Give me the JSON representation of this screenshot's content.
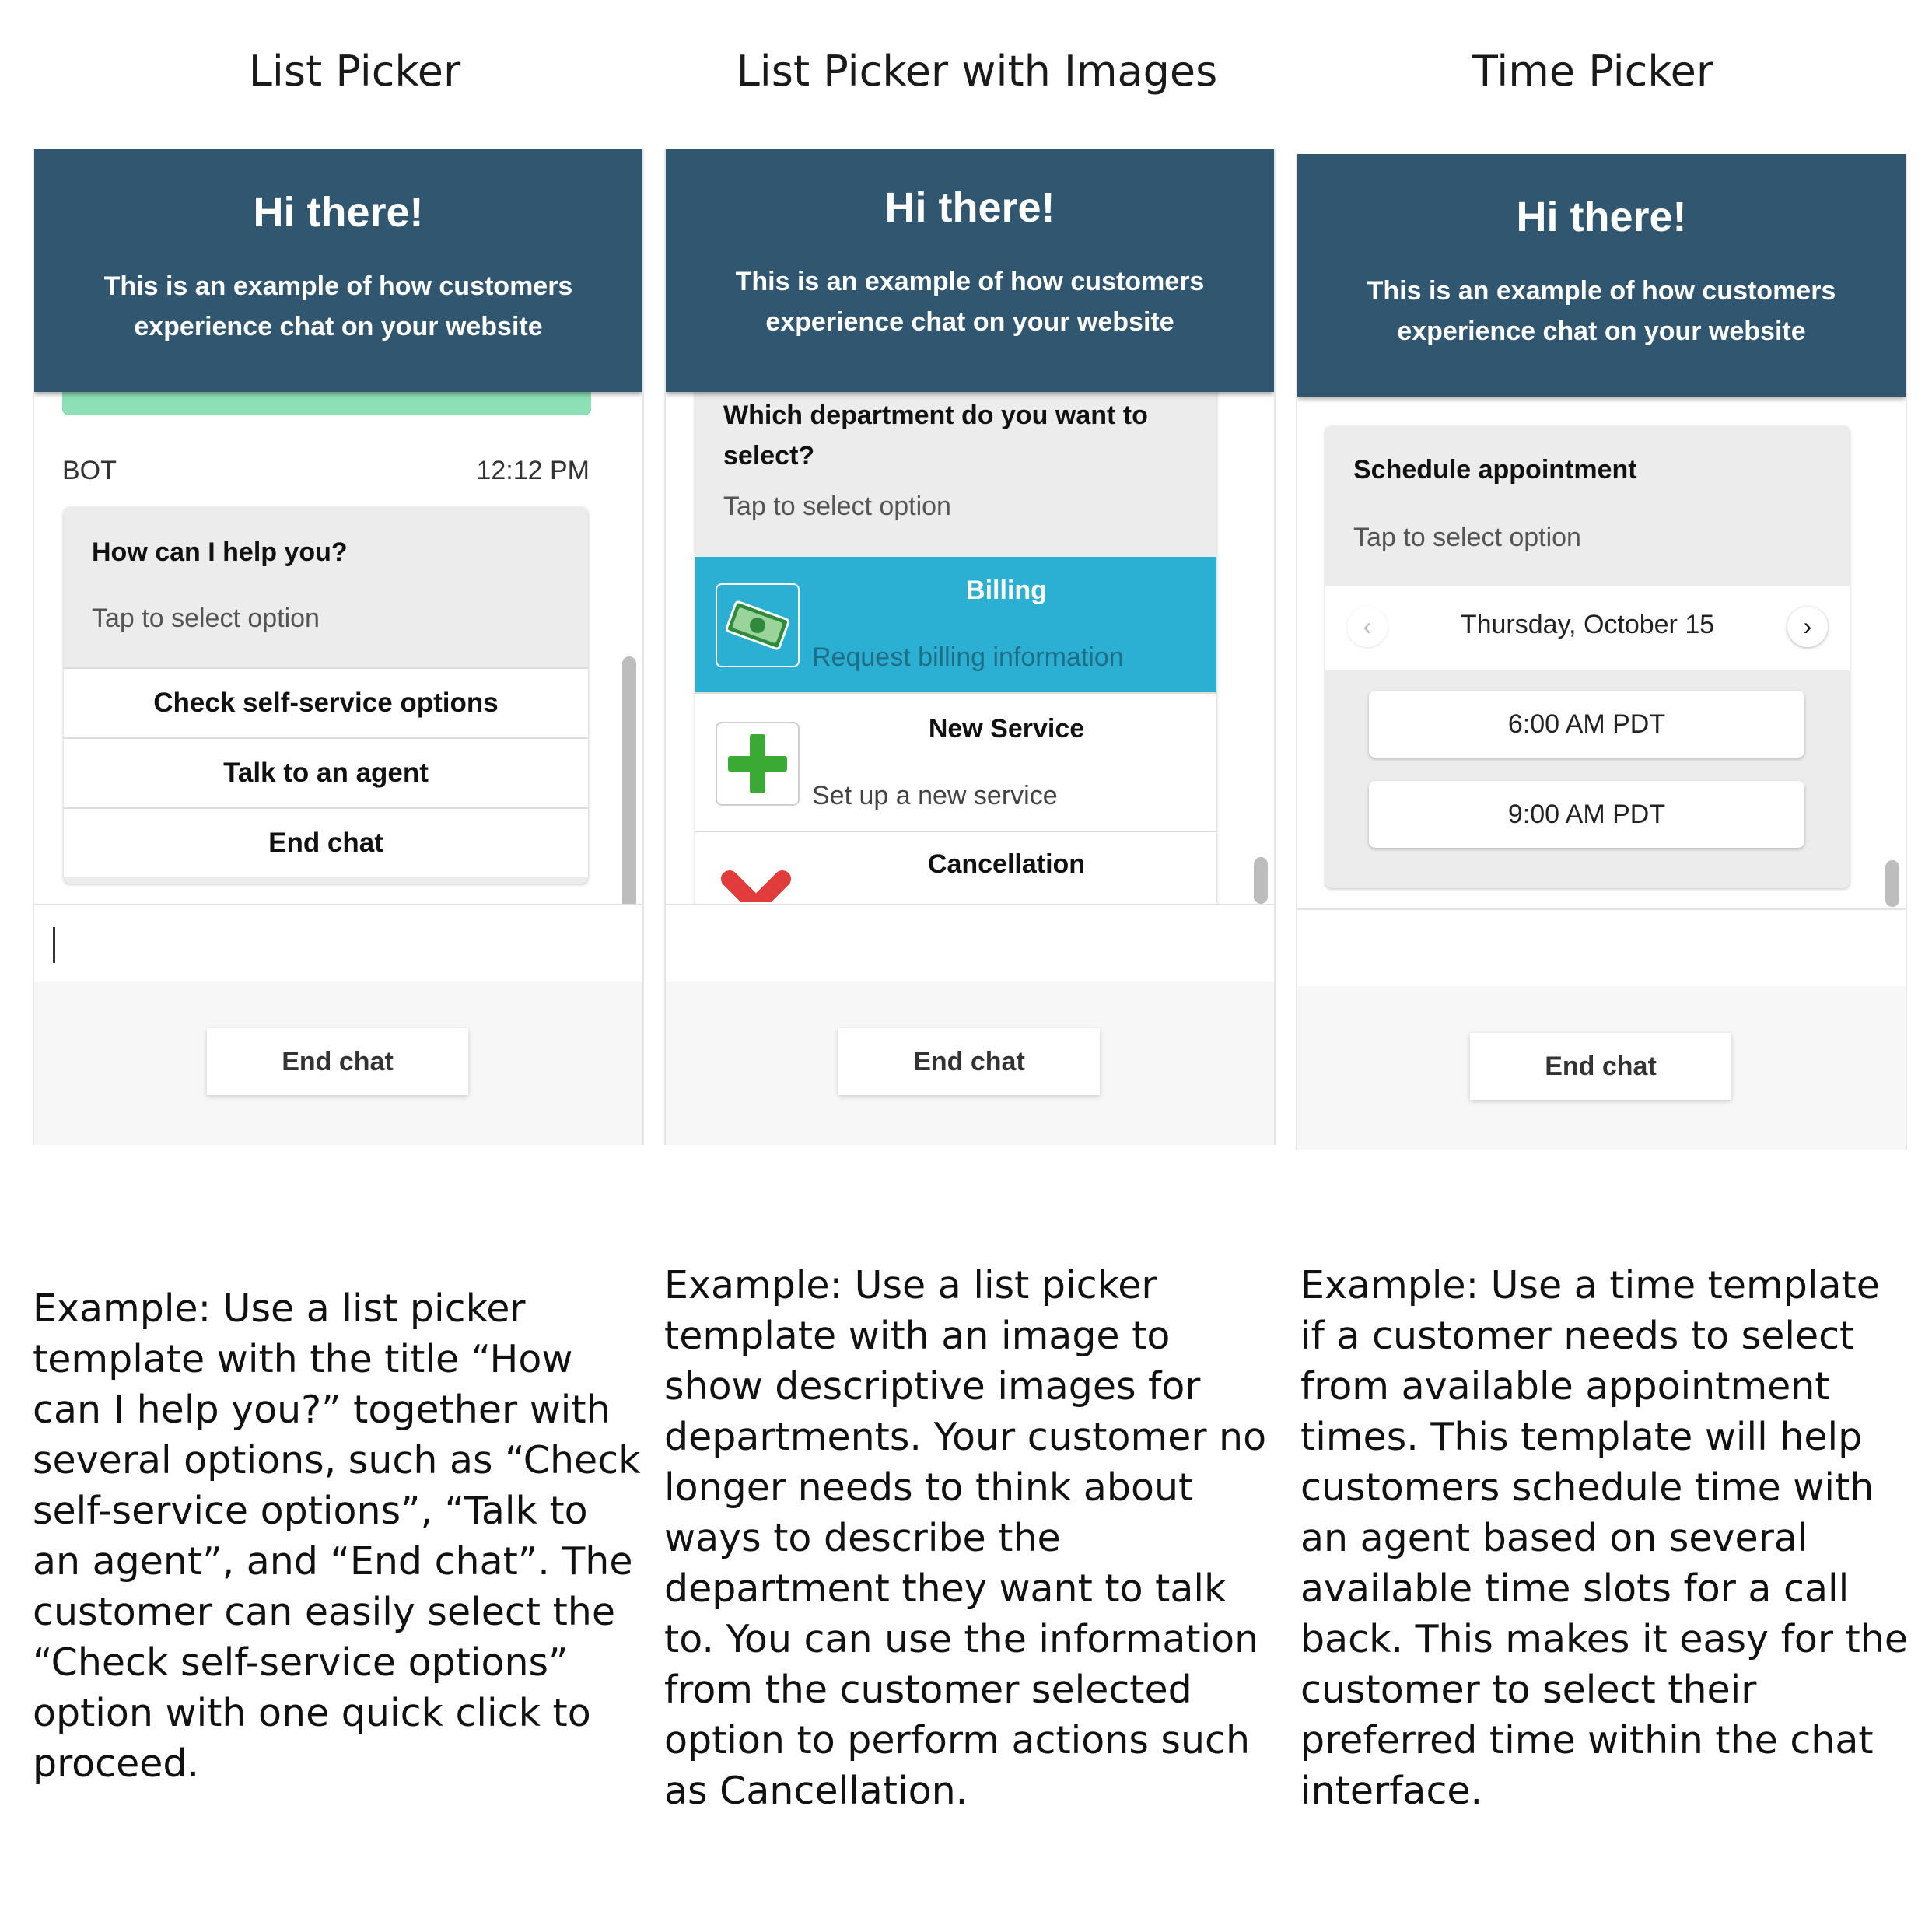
{
  "columns": [
    {
      "title": "List Picker"
    },
    {
      "title": "List Picker with Images"
    },
    {
      "title": "Time Picker"
    }
  ],
  "header": {
    "greeting": "Hi there!",
    "subtitle": "This is an example of how customers experience chat on your website"
  },
  "footer": {
    "end_chat_label": "End chat"
  },
  "list_picker": {
    "sender": "BOT",
    "timestamp": "12:12 PM",
    "card_title": "How can I help you?",
    "card_subtitle": "Tap to select option",
    "options": [
      "Check self-service options",
      "Talk to an agent",
      "End chat"
    ]
  },
  "image_picker": {
    "card_title": "Which department do you want to select?",
    "card_subtitle": "Tap to select option",
    "options": [
      {
        "title": "Billing",
        "subtitle": "Request billing information",
        "icon": "money-icon",
        "selected": true
      },
      {
        "title": "New Service",
        "subtitle": "Set up a new service",
        "icon": "plus-icon",
        "selected": false
      },
      {
        "title": "Cancellation",
        "subtitle": "",
        "icon": "x-icon",
        "selected": false
      }
    ]
  },
  "time_picker": {
    "card_title": "Schedule appointment",
    "card_subtitle": "Tap to select option",
    "date": "Thursday, October 15",
    "slots": [
      "6:00 AM PDT",
      "9:00 AM PDT"
    ]
  },
  "descriptions": [
    "Example: Use a list picker template with the title “How can I help you?” together with several options, such as “Check self-service options”, “Talk to an agent”, and “End chat”. The customer can easily select the “Check self-service options” option with one quick click to proceed.",
    "Example: Use a list picker template with an image to show descriptive images for departments. Your customer no longer needs to think about ways to describe the department they want to talk to. You can use the information from the customer selected option to perform actions such as Cancellation.",
    "Example: Use a time template if a customer needs to select from available appointment times. This template will help customers schedule time with an agent based on several available time slots for a call back. This makes it easy for the customer to select their preferred time within the chat interface."
  ],
  "colors": {
    "header_bg": "#305670",
    "selected_option_bg": "#2bb0d4",
    "customer_bubble": "#8de0b5",
    "plus_icon": "#3aaa35",
    "cancel_icon": "#e23b3b"
  }
}
